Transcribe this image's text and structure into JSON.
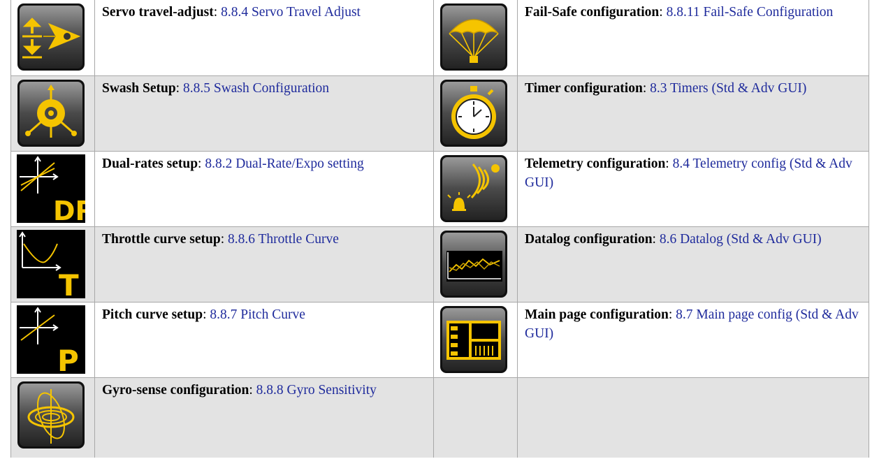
{
  "rows": [
    {
      "left": {
        "icon": "servo-travel-adjust-icon",
        "label": "Servo travel-adjust",
        "sep": ": ",
        "link": "8.8.4 Servo Travel Adjust"
      },
      "right": {
        "icon": "parachute-failsafe-icon",
        "label": "Fail-Safe configuration",
        "sep": ": ",
        "link": "8.8.11 Fail-Safe Configuration"
      }
    },
    {
      "left": {
        "icon": "swash-setup-icon",
        "label": "Swash Setup",
        "sep": ": ",
        "link": "8.8.5 Swash Configuration"
      },
      "right": {
        "icon": "stopwatch-timer-icon",
        "label": "Timer configuration",
        "sep": ": ",
        "link": "8.3 Timers (Std & Adv GUI)"
      }
    },
    {
      "left": {
        "icon": "dual-rate-icon",
        "label": "Dual-rates setup",
        "sep": ": ",
        "link": "8.8.2 Dual-Rate/Expo setting",
        "icon_text": "DR"
      },
      "right": {
        "icon": "telemetry-alarm-icon",
        "label": "Telemetry configuration",
        "sep": ": ",
        "link": "8.4 Telemetry config (Std & Adv GUI)"
      }
    },
    {
      "left": {
        "icon": "throttle-curve-icon",
        "label": "Throttle curve setup",
        "sep": ": ",
        "link": "8.8.6 Throttle Curve",
        "icon_text": "T"
      },
      "right": {
        "icon": "datalog-graph-icon",
        "label": "Datalog configuration",
        "sep": ": ",
        "link": "8.6 Datalog (Std & Adv GUI)"
      }
    },
    {
      "left": {
        "icon": "pitch-curve-icon",
        "label": "Pitch curve setup",
        "sep": ": ",
        "link": "8.8.7 Pitch Curve",
        "icon_text": "P"
      },
      "right": {
        "icon": "main-page-layout-icon",
        "label": "Main page configuration",
        "sep": ": ",
        "link": "8.7 Main page config (Std & Adv GUI)"
      }
    },
    {
      "left": {
        "icon": "gyro-gimbal-icon",
        "label": "Gyro-sense configuration",
        "sep": ": ",
        "link": "8.8.8 Gyro Sensitivity"
      },
      "right": null
    }
  ],
  "colors": {
    "link": "#1f2b9c",
    "icon_accent": "#f5c400",
    "shade": "#e3e3e3"
  }
}
